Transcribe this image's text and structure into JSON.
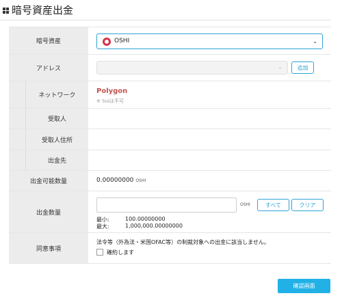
{
  "header": {
    "title": "暗号資産出金"
  },
  "form": {
    "asset": {
      "label": "暗号資産",
      "selected": "OSHI"
    },
    "address": {
      "label": "アドレス",
      "add_button": "追加"
    },
    "network": {
      "label": "ネットワーク",
      "value": "Polygon",
      "note": "※ Suiは不可"
    },
    "recipient": {
      "label": "受取人"
    },
    "recipient_address": {
      "label": "受取人住所"
    },
    "destination": {
      "label": "出金先"
    },
    "available": {
      "label": "出金可能数量",
      "value": "0.00000000",
      "unit": "OSHI"
    },
    "amount": {
      "label": "出金数量",
      "unit": "OSHI",
      "all_button": "すべて",
      "clear_button": "クリア",
      "min_label": "最小:",
      "min_value": "100.00000000",
      "max_label": "最大:",
      "max_value": "1,000,000.00000000"
    },
    "consent": {
      "label": "同意事項",
      "text": "法令等（外為法・米国OFAC等）の制裁対象への出金に該当しません。",
      "checkbox_label": "確約します"
    }
  },
  "confirm_button": "確認画面",
  "colors": {
    "accent": "#2fa4d6",
    "primary_button": "#21b1e6",
    "network": "#c0534d",
    "asset_icon": "#d6314a"
  },
  "icons": {
    "header": "grid-icon",
    "asset": "oshi-coin-icon",
    "dropdown": "chevron-down-icon"
  }
}
